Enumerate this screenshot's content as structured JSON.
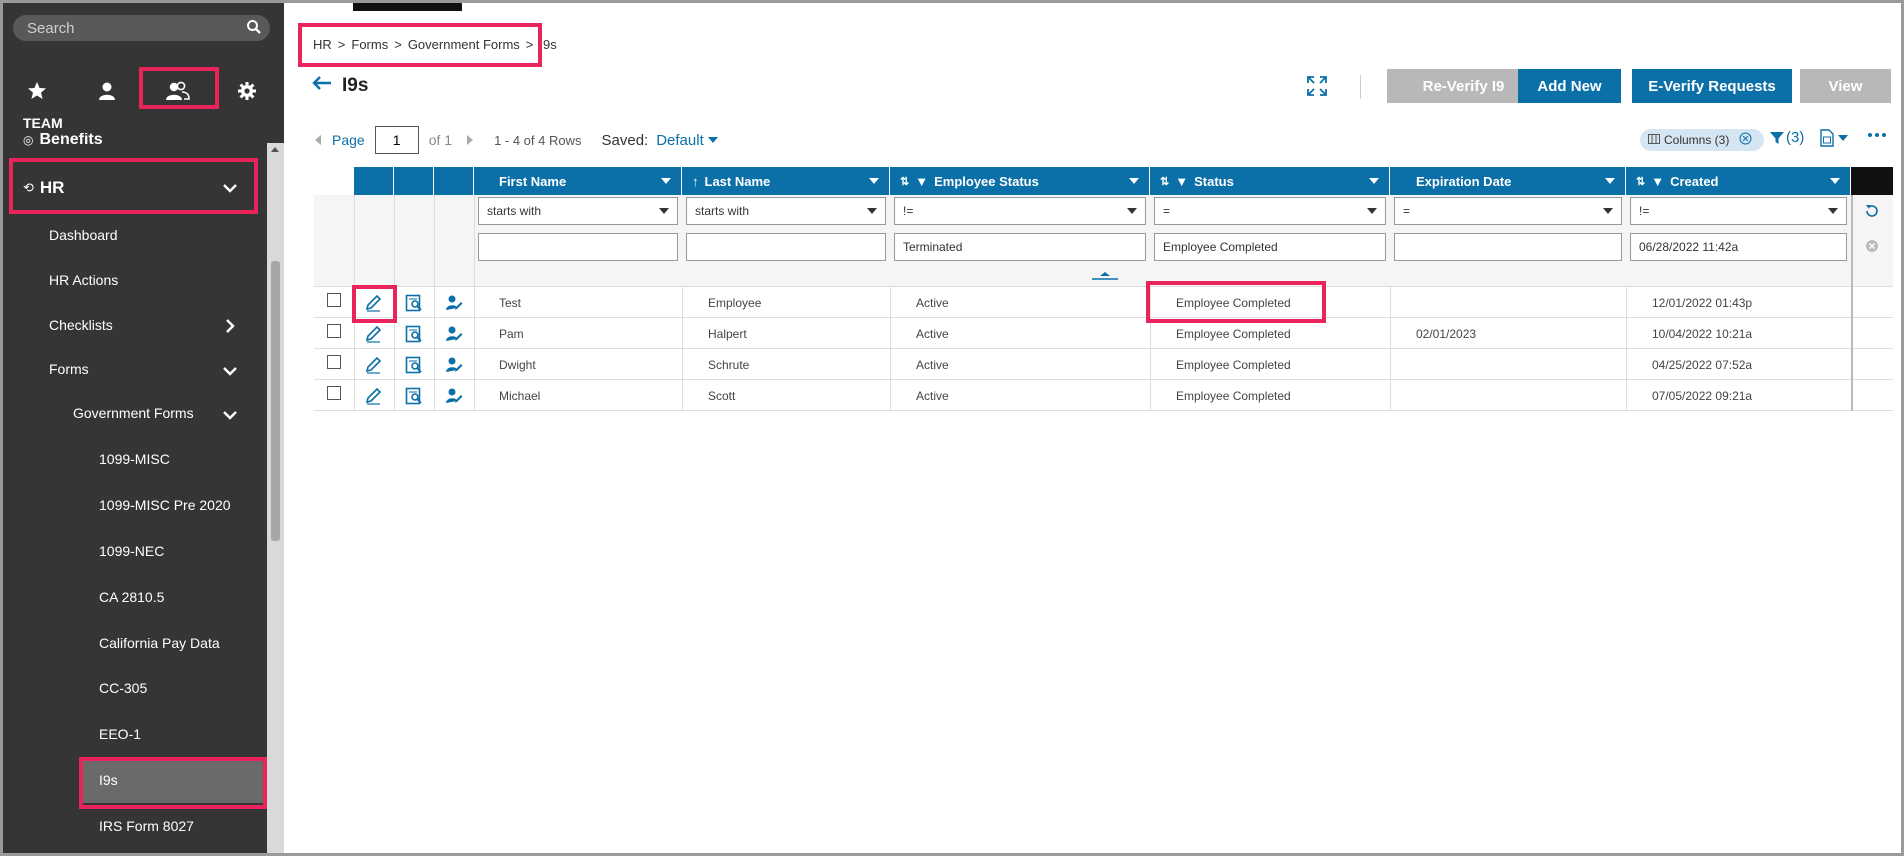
{
  "sidebar": {
    "search_placeholder": "Search",
    "nav_icons": [
      "star-icon",
      "person-icon",
      "team-icon",
      "gear-icon"
    ],
    "section_label": "TEAM",
    "items": [
      {
        "label": "Benefits"
      },
      {
        "label": "HR"
      },
      {
        "label": "Dashboard"
      },
      {
        "label": "HR Actions"
      },
      {
        "label": "Checklists"
      },
      {
        "label": "Forms"
      },
      {
        "label": "Government Forms"
      },
      {
        "label": "1099-MISC"
      },
      {
        "label": "1099-MISC Pre 2020"
      },
      {
        "label": "1099-NEC"
      },
      {
        "label": "CA 2810.5"
      },
      {
        "label": "California Pay Data"
      },
      {
        "label": "CC-305"
      },
      {
        "label": "EEO-1"
      },
      {
        "label": "I9s"
      },
      {
        "label": "IRS Form 8027"
      }
    ]
  },
  "breadcrumb": {
    "items": [
      "HR",
      "Forms",
      "Government Forms",
      "I9s"
    ],
    "separator": ">"
  },
  "header": {
    "title": "I9s",
    "buttons": {
      "reverify": "Re-Verify I9",
      "add_new": "Add New",
      "everify": "E-Verify Requests",
      "view": "View"
    }
  },
  "toolbar": {
    "page_label": "Page",
    "page_value": "1",
    "of_label": "of 1",
    "rows_text": "1 - 4 of 4 Rows",
    "saved_label": "Saved:",
    "saved_value": "Default",
    "columns_label": "Columns (3)",
    "filter_count": "(3)"
  },
  "grid": {
    "columns": [
      {
        "label": "First Name"
      },
      {
        "label": "Last Name"
      },
      {
        "label": "Employee Status"
      },
      {
        "label": "Status"
      },
      {
        "label": "Expiration Date"
      },
      {
        "label": "Created"
      }
    ],
    "filters": {
      "ops": [
        "starts with",
        "starts with",
        "!=",
        "=",
        "=",
        "!="
      ],
      "values": [
        "",
        "",
        "Terminated",
        "Employee Completed",
        "",
        "06/28/2022 11:42a"
      ]
    },
    "rows": [
      {
        "first": "Test",
        "last": "Employee",
        "emp_status": "Active",
        "status": "Employee Completed",
        "expiration": "",
        "created": "12/01/2022 01:43p"
      },
      {
        "first": "Pam",
        "last": "Halpert",
        "emp_status": "Active",
        "status": "Employee Completed",
        "expiration": "02/01/2023",
        "created": "10/04/2022 10:21a"
      },
      {
        "first": "Dwight",
        "last": "Schrute",
        "emp_status": "Active",
        "status": "Employee Completed",
        "expiration": "",
        "created": "04/25/2022 07:52a"
      },
      {
        "first": "Michael",
        "last": "Scott",
        "emp_status": "Active",
        "status": "Employee Completed",
        "expiration": "",
        "created": "07/05/2022 09:21a"
      }
    ]
  },
  "colors": {
    "accent": "#0b6fa8",
    "highlight": "#e8245a",
    "sidebar_bg": "#353535"
  }
}
